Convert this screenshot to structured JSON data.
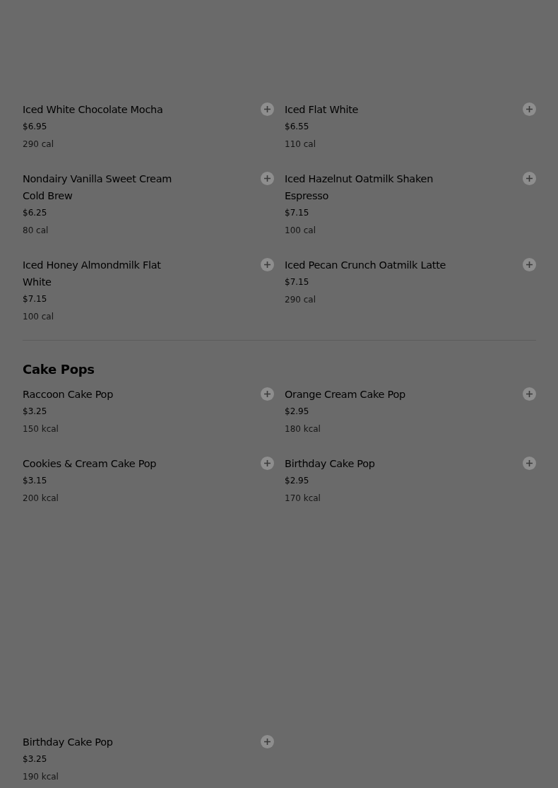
{
  "sections": [
    {
      "items": [
        {
          "name": "Iced White Chocolate Mocha",
          "price": "$6.95",
          "calories": "290 cal"
        },
        {
          "name": "Iced Flat White",
          "price": "$6.55",
          "calories": "110 cal"
        },
        {
          "name": "Nondairy Vanilla Sweet Cream Cold Brew",
          "price": "$6.25",
          "calories": "80 cal"
        },
        {
          "name": "Iced Hazelnut Oatmilk Shaken Espresso",
          "price": "$7.15",
          "calories": "100 cal"
        },
        {
          "name": "Iced Honey Almondmilk Flat White",
          "price": "$7.15",
          "calories": "100 cal"
        },
        {
          "name": "Iced Pecan Crunch Oatmilk Latte",
          "price": "$7.15",
          "calories": "290 cal"
        }
      ]
    },
    {
      "title": "Cake Pops",
      "items": [
        {
          "name": "Raccoon Cake Pop",
          "price": "$3.25",
          "calories": "150 kcal"
        },
        {
          "name": "Orange Cream Cake Pop",
          "price": "$2.95",
          "calories": "180 kcal"
        },
        {
          "name": "Cookies & Cream Cake Pop",
          "price": "$3.15",
          "calories": "200 kcal"
        },
        {
          "name": "Birthday Cake Pop",
          "price": "$2.95",
          "calories": "170 kcal"
        }
      ]
    },
    {
      "items": [
        {
          "name": "Birthday Cake Pop",
          "price": "$3.25",
          "calories": "190 kcal"
        }
      ]
    }
  ]
}
